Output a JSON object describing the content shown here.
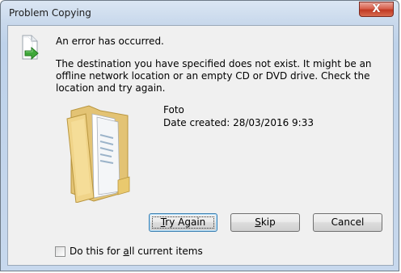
{
  "window": {
    "title": "Problem Copying",
    "close_glyph": "X"
  },
  "dialog": {
    "heading": "An error has occurred.",
    "message": "The destination you have specified does not exist. It might be an offline network location or an empty CD or DVD drive. Check the location and try again.",
    "icons": {
      "error_icon": "document-with-green-arrow-icon",
      "item_icon": "folder-icon"
    }
  },
  "item": {
    "name": "Foto",
    "date_created": "Date created: 28/03/2016 9:33"
  },
  "buttons": {
    "try_again": {
      "pre": "",
      "mnemonic": "T",
      "post": "ry Again"
    },
    "skip": {
      "pre": "",
      "mnemonic": "S",
      "post": "kip"
    },
    "cancel": {
      "label": "Cancel"
    }
  },
  "checkbox": {
    "pre": "Do this for ",
    "mnemonic": "a",
    "post": "ll current items",
    "checked": false
  }
}
